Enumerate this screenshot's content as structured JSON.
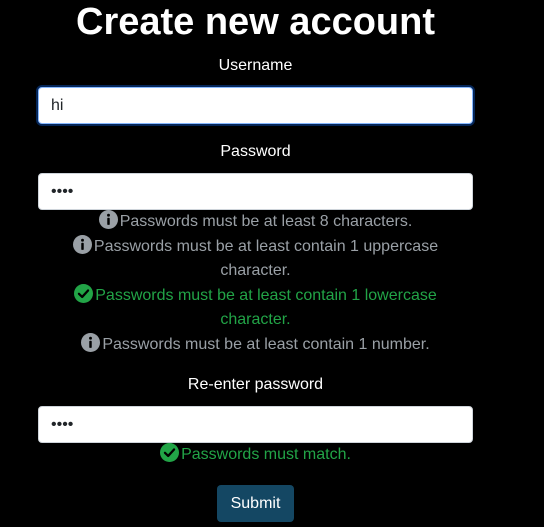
{
  "page": {
    "title": "Create new account"
  },
  "colors": {
    "info": "#9aa0a6",
    "ok": "#22a447",
    "button": "#144763"
  },
  "form": {
    "username": {
      "label": "Username",
      "value": "hi"
    },
    "password": {
      "label": "Password",
      "value": "••••",
      "rules": [
        {
          "status": "info",
          "icon": "info-icon",
          "text": "Passwords must be at least 8 characters."
        },
        {
          "status": "info",
          "icon": "info-icon",
          "text": "Passwords must be at least contain 1 uppercase character."
        },
        {
          "status": "ok",
          "icon": "check-circle-icon",
          "text": "Passwords must be at least contain 1 lowercase character."
        },
        {
          "status": "info",
          "icon": "info-icon",
          "text": "Passwords must be at least contain 1 number."
        }
      ]
    },
    "reenter": {
      "label": "Re-enter password",
      "value": "••••",
      "rules": [
        {
          "status": "ok",
          "icon": "check-circle-icon",
          "text": "Passwords must match."
        }
      ]
    },
    "submit_label": "Submit"
  }
}
